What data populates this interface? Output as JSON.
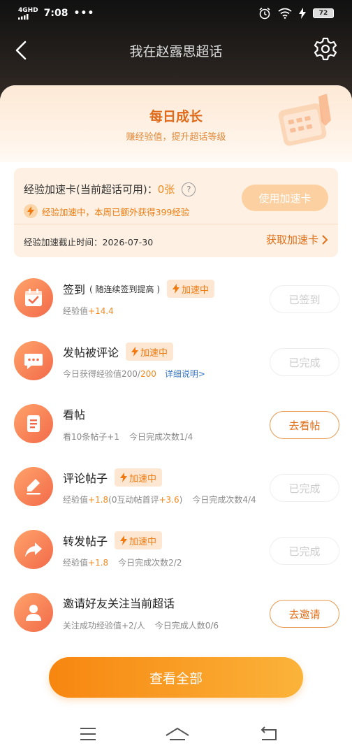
{
  "status_bar": {
    "network": "4GHD",
    "time": "7:08",
    "dots": "•••",
    "battery": "72"
  },
  "nav": {
    "title": "我在赵露思超话"
  },
  "header": {
    "title": "每日成长",
    "subtitle": "赚经验值，提升超话等级"
  },
  "boost_card": {
    "label": "经验加速卡(当前超话可用)：",
    "count": "0张",
    "status": "经验加速中，本周已额外获得399经验",
    "use_button": "使用加速卡",
    "deadline": "经验加速截止时间：2026-07-30",
    "get_link": "获取加速卡"
  },
  "boost_tag": "加速中",
  "tasks": [
    {
      "title": "签到",
      "note": "( 随连续签到提高 )",
      "desc_prefix": "经验值",
      "desc_value": "+14.4",
      "button": "已签到"
    },
    {
      "title": "发帖被评论",
      "desc_prefix": "今日获得经验值200/",
      "desc_value": "200",
      "link": "详细说明>",
      "button": "已完成"
    },
    {
      "title": "看帖",
      "desc_prefix": "看10条帖子+1",
      "desc_count": "今日完成次数1/4",
      "button": "去看帖"
    },
    {
      "title": "评论帖子",
      "desc_prefix": "经验值",
      "desc_value": "+1.8",
      "desc_mid": "(0互动帖首评",
      "desc_value2": "+3.6",
      "desc_end": ")",
      "desc_count": "今日完成次数4/4",
      "button": "已完成"
    },
    {
      "title": "转发帖子",
      "desc_prefix": "经验值",
      "desc_value": "+1.8",
      "desc_count": "今日完成次数2/2",
      "button": "已完成"
    },
    {
      "title": "邀请好友关注当前超话",
      "desc_prefix": "关注成功经验值+2/人",
      "desc_count": "今日完成人数0/6",
      "button": "去邀请"
    }
  ],
  "view_all": "查看全部",
  "colors": {
    "accent": "#f08a20",
    "link": "#3a78c8",
    "icon_gradient_start": "#ffa36a",
    "icon_gradient_end": "#f26a4a"
  }
}
